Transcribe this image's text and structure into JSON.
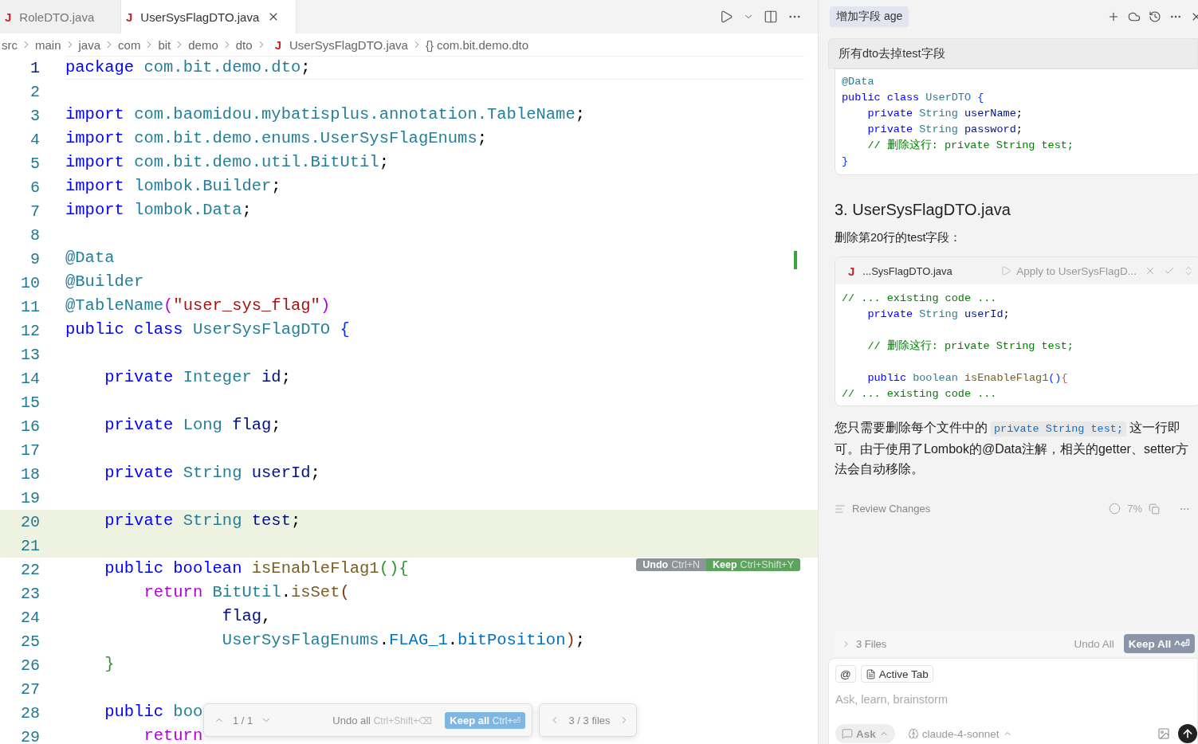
{
  "tabs": [
    {
      "icon": "J",
      "label": "RoleDTO.java",
      "selected": false
    },
    {
      "icon": "J",
      "label": "UserSysFlagDTO.java",
      "selected": true
    }
  ],
  "breadcrumb": [
    "src",
    "main",
    "java",
    "com",
    "bit",
    "demo",
    "dto"
  ],
  "breadcrumb_file": {
    "icon": "J",
    "label": "UserSysFlagDTO.java"
  },
  "breadcrumb_symbol": {
    "icon": "{}",
    "label": "com.bit.demo.dto"
  },
  "editor": {
    "lines": [
      {
        "number": "1",
        "current": true,
        "highlighted": false,
        "tokens": [
          {
            "kind": "kw",
            "text": "package "
          },
          {
            "kind": "ns",
            "text": "com.bit.demo.dto"
          },
          {
            "kind": "p",
            "text": ";"
          }
        ]
      },
      {
        "number": "2",
        "current": false,
        "highlighted": false
      },
      {
        "number": "3",
        "current": false,
        "highlighted": false,
        "tokens": [
          {
            "kind": "kw",
            "text": "import "
          },
          {
            "kind": "ns",
            "text": "com.baomidou.mybatisplus.annotation.TableName"
          },
          {
            "kind": "p",
            "text": ";"
          }
        ]
      },
      {
        "number": "4",
        "current": false,
        "highlighted": false,
        "tokens": [
          {
            "kind": "kw",
            "text": "import "
          },
          {
            "kind": "ns",
            "text": "com.bit.demo.enums.UserSysFlagEnums"
          },
          {
            "kind": "p",
            "text": ";"
          }
        ]
      },
      {
        "number": "5",
        "current": false,
        "highlighted": false,
        "tokens": [
          {
            "kind": "kw",
            "text": "import "
          },
          {
            "kind": "ns",
            "text": "com.bit.demo.util.BitUtil"
          },
          {
            "kind": "p",
            "text": ";"
          }
        ]
      },
      {
        "number": "6",
        "current": false,
        "highlighted": false,
        "tokens": [
          {
            "kind": "kw",
            "text": "import "
          },
          {
            "kind": "ns",
            "text": "lombok.Builder"
          },
          {
            "kind": "p",
            "text": ";"
          }
        ]
      },
      {
        "number": "7",
        "current": false,
        "highlighted": false,
        "tokens": [
          {
            "kind": "kw",
            "text": "import "
          },
          {
            "kind": "ns",
            "text": "lombok.Data"
          },
          {
            "kind": "p",
            "text": ";"
          }
        ]
      },
      {
        "number": "8",
        "current": false,
        "highlighted": false
      },
      {
        "number": "9",
        "current": false,
        "highlighted": false,
        "tokens": [
          {
            "kind": "ann",
            "text": "@Data"
          }
        ]
      },
      {
        "number": "10",
        "current": false,
        "highlighted": false,
        "tokens": [
          {
            "kind": "ann",
            "text": "@Builder"
          }
        ]
      },
      {
        "number": "11",
        "current": false,
        "highlighted": false,
        "tokens": [
          {
            "kind": "ann",
            "text": "@TableName"
          },
          {
            "kind": "br1",
            "text": "("
          },
          {
            "kind": "str",
            "text": "\"user_sys_flag\""
          },
          {
            "kind": "br1",
            "text": ")"
          }
        ]
      },
      {
        "number": "12",
        "current": false,
        "highlighted": false,
        "tokens": [
          {
            "kind": "kw",
            "text": "public class "
          },
          {
            "kind": "type",
            "text": "UserSysFlagDTO "
          },
          {
            "kind": "br2",
            "text": "{"
          }
        ]
      },
      {
        "number": "13",
        "current": false,
        "highlighted": false
      },
      {
        "number": "14",
        "current": false,
        "highlighted": false,
        "tokens": [
          {
            "kind": "kw",
            "text": "    private "
          },
          {
            "kind": "type",
            "text": "Integer "
          },
          {
            "kind": "var",
            "text": "id"
          },
          {
            "kind": "p",
            "text": ";"
          }
        ]
      },
      {
        "number": "15",
        "current": false,
        "highlighted": false
      },
      {
        "number": "16",
        "current": false,
        "highlighted": false,
        "tokens": [
          {
            "kind": "kw",
            "text": "    private "
          },
          {
            "kind": "type",
            "text": "Long "
          },
          {
            "kind": "var",
            "text": "flag"
          },
          {
            "kind": "p",
            "text": ";"
          }
        ]
      },
      {
        "number": "17",
        "current": false,
        "highlighted": false
      },
      {
        "number": "18",
        "current": false,
        "highlighted": false,
        "tokens": [
          {
            "kind": "kw",
            "text": "    private "
          },
          {
            "kind": "type",
            "text": "String "
          },
          {
            "kind": "var",
            "text": "userId"
          },
          {
            "kind": "p",
            "text": ";"
          }
        ]
      },
      {
        "number": "19",
        "current": false,
        "highlighted": false
      },
      {
        "number": "20",
        "current": false,
        "highlighted": true,
        "tokens": [
          {
            "kind": "kw",
            "text": "    private "
          },
          {
            "kind": "type",
            "text": "String "
          },
          {
            "kind": "var",
            "text": "test"
          },
          {
            "kind": "p",
            "text": ";"
          }
        ]
      },
      {
        "number": "21",
        "current": false,
        "highlighted": true
      },
      {
        "number": "22",
        "current": false,
        "highlighted": false,
        "tokens": [
          {
            "kind": "kw",
            "text": "    public boolean "
          },
          {
            "kind": "fn",
            "text": "isEnableFlag1"
          },
          {
            "kind": "br3",
            "text": "(){"
          }
        ]
      },
      {
        "number": "23",
        "current": false,
        "highlighted": false,
        "tokens": [
          {
            "kind": "ctrl",
            "text": "        return "
          },
          {
            "kind": "type",
            "text": "BitUtil"
          },
          {
            "kind": "p",
            "text": "."
          },
          {
            "kind": "fn",
            "text": "isSet"
          },
          {
            "kind": "br4",
            "text": "("
          }
        ]
      },
      {
        "number": "24",
        "current": false,
        "highlighted": false,
        "tokens": [
          {
            "kind": "var",
            "text": "                flag"
          },
          {
            "kind": "p",
            "text": ","
          }
        ]
      },
      {
        "number": "25",
        "current": false,
        "highlighted": false,
        "tokens": [
          {
            "kind": "type",
            "text": "                UserSysFlagEnums"
          },
          {
            "kind": "p",
            "text": "."
          },
          {
            "kind": "const",
            "text": "FLAG_1"
          },
          {
            "kind": "p",
            "text": "."
          },
          {
            "kind": "const",
            "text": "bitPosition"
          },
          {
            "kind": "br4",
            "text": ")"
          },
          {
            "kind": "p",
            "text": ";"
          }
        ]
      },
      {
        "number": "26",
        "current": false,
        "highlighted": false,
        "tokens": [
          {
            "kind": "br3",
            "text": "    }"
          }
        ]
      },
      {
        "number": "27",
        "current": false,
        "highlighted": false
      },
      {
        "number": "28",
        "current": false,
        "highlighted": false,
        "tokens": [
          {
            "kind": "kw",
            "text": "    public "
          },
          {
            "kind": "type",
            "text": "boo"
          }
        ]
      },
      {
        "number": "29",
        "current": false,
        "highlighted": false,
        "tokens": [
          {
            "kind": "ctrl",
            "text": "        return"
          }
        ]
      }
    ],
    "inline_actions": [
      {
        "label": "Undo",
        "shortcut": "Ctrl+N",
        "kind": "undo"
      },
      {
        "label": "Keep",
        "shortcut": "Ctrl+Shift+Y",
        "kind": "keep"
      }
    ],
    "review_bar": {
      "position": "1 / 1",
      "undo": {
        "label": "Undo all",
        "shortcut": "Ctrl+Shift+⌫"
      },
      "keep": {
        "label": "Keep all",
        "shortcut": "Ctrl+⏎"
      },
      "files": "3 / 3 files"
    }
  },
  "chat": {
    "title": "增加字段 age",
    "user_message": "所有dto去掉test字段",
    "code_block_1": [
      {
        "tokens": [
          {
            "kind": "ann",
            "text": "@Data"
          }
        ]
      },
      {
        "tokens": [
          {
            "kind": "kw",
            "text": "public class "
          },
          {
            "kind": "type",
            "text": "UserDTO "
          },
          {
            "kind": "br2",
            "text": "{"
          }
        ]
      },
      {
        "tokens": [
          {
            "kind": "kw",
            "text": "    private "
          },
          {
            "kind": "type",
            "text": "String "
          },
          {
            "kind": "var",
            "text": "userName"
          },
          {
            "kind": "p",
            "text": ";"
          }
        ]
      },
      {
        "tokens": [
          {
            "kind": "kw",
            "text": "    private "
          },
          {
            "kind": "type",
            "text": "String "
          },
          {
            "kind": "var",
            "text": "password"
          },
          {
            "kind": "p",
            "text": ";"
          }
        ]
      },
      {
        "tokens": [
          {
            "kind": "cm",
            "text": "    // 删除这行: private String test;"
          }
        ]
      },
      {
        "tokens": [
          {
            "kind": "br2",
            "text": "}"
          }
        ]
      }
    ],
    "heading": "3. UserSysFlagDTO.java",
    "instruction": "删除第20行的test字段：",
    "code_card": {
      "icon": "J",
      "file": "...SysFlagDTO.java",
      "apply": "Apply to UserSysFlagD...",
      "lines": [
        {
          "tokens": [
            {
              "kind": "cm",
              "text": "// ... existing code ..."
            }
          ]
        },
        {
          "tokens": [
            {
              "kind": "kw",
              "text": "    private "
            },
            {
              "kind": "type",
              "text": "String "
            },
            {
              "kind": "var",
              "text": "userId"
            },
            {
              "kind": "p",
              "text": ";"
            }
          ]
        },
        {
          "blank": true
        },
        {
          "tokens": [
            {
              "kind": "cm",
              "text": "    // 删除这行: private String test;"
            }
          ]
        },
        {
          "blank": true
        },
        {
          "tokens": [
            {
              "kind": "kw",
              "text": "    public "
            },
            {
              "kind": "type",
              "text": "boolean "
            },
            {
              "kind": "fn",
              "text": "isEnableFlag1"
            },
            {
              "kind": "br2",
              "text": "()"
            },
            {
              "kind": "br5",
              "text": "{"
            }
          ]
        },
        {
          "tokens": [
            {
              "kind": "cm",
              "text": "// ... existing code ..."
            }
          ]
        }
      ]
    },
    "summary": {
      "before": "您只需要删除每个文件中的",
      "code": "private String test;",
      "after": "这一行即可。由于使用了Lombok的@Data注解，相关的getter、setter方法会自动移除。"
    },
    "review": {
      "label": "Review Changes",
      "progress": "7%"
    },
    "files_bar": {
      "label": "3 Files",
      "undo": "Undo All",
      "keep": "Keep All ^⏎"
    },
    "input": {
      "mention": "@",
      "context_chip": "Active Tab",
      "placeholder": "Ask, learn, brainstorm",
      "mode": "Ask",
      "model": "claude-4-sonnet"
    }
  }
}
